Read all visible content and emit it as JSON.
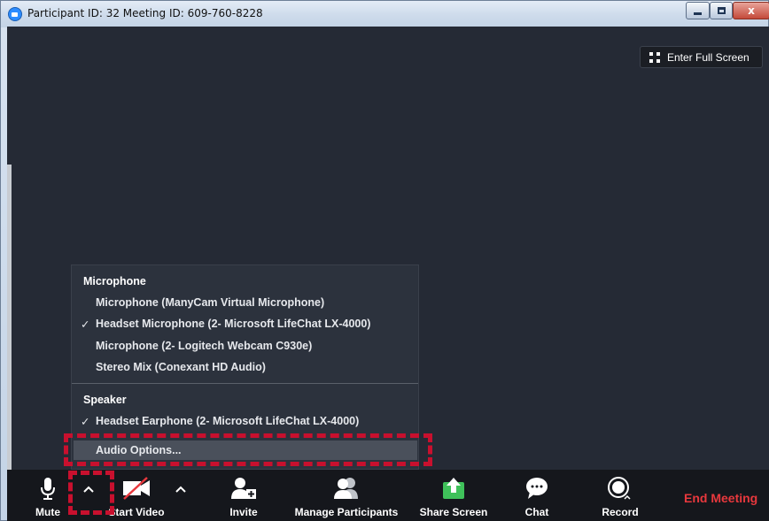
{
  "window": {
    "title": "Participant ID: 32   Meeting ID: 609-760-8228",
    "close_glyph": "x"
  },
  "meeting": {
    "fullscreen_label": "Enter Full Screen"
  },
  "audio_menu": {
    "microphone_heading": "Microphone",
    "microphones": [
      "Microphone (ManyCam Virtual Microphone)",
      "Headset Microphone (2- Microsoft LifeChat LX-4000)",
      "Microphone (2- Logitech Webcam C930e)",
      "Stereo Mix (Conexant HD Audio)"
    ],
    "selected_microphone_index": 1,
    "speaker_heading": "Speaker",
    "speakers": [
      "Headset Earphone (2- Microsoft LifeChat LX-4000)"
    ],
    "selected_speaker_index": 0,
    "audio_options_label": "Audio Options..."
  },
  "toolbar": {
    "mute_label": "Mute",
    "start_video_label": "Start Video",
    "invite_label": "Invite",
    "manage_participants_label": "Manage Participants",
    "share_screen_label": "Share Screen",
    "chat_label": "Chat",
    "record_label": "Record",
    "end_meeting_label": "End Meeting"
  },
  "colors": {
    "meeting_bg": "#252a35",
    "toolbar_bg": "#15171c",
    "menu_bg": "#2c323d",
    "end_meeting": "#e8383d",
    "share_screen_green": "#3fc15a",
    "highlight_red": "#c8102e"
  },
  "icons": {
    "app": "zoom-logo-icon",
    "fullscreen": "expand-icon",
    "mute": "microphone-icon",
    "start_video": "video-off-icon",
    "invite": "add-person-icon",
    "manage_participants": "people-icon",
    "share_screen": "share-arrow-icon",
    "chat": "chat-bubble-icon",
    "record": "record-icon"
  }
}
